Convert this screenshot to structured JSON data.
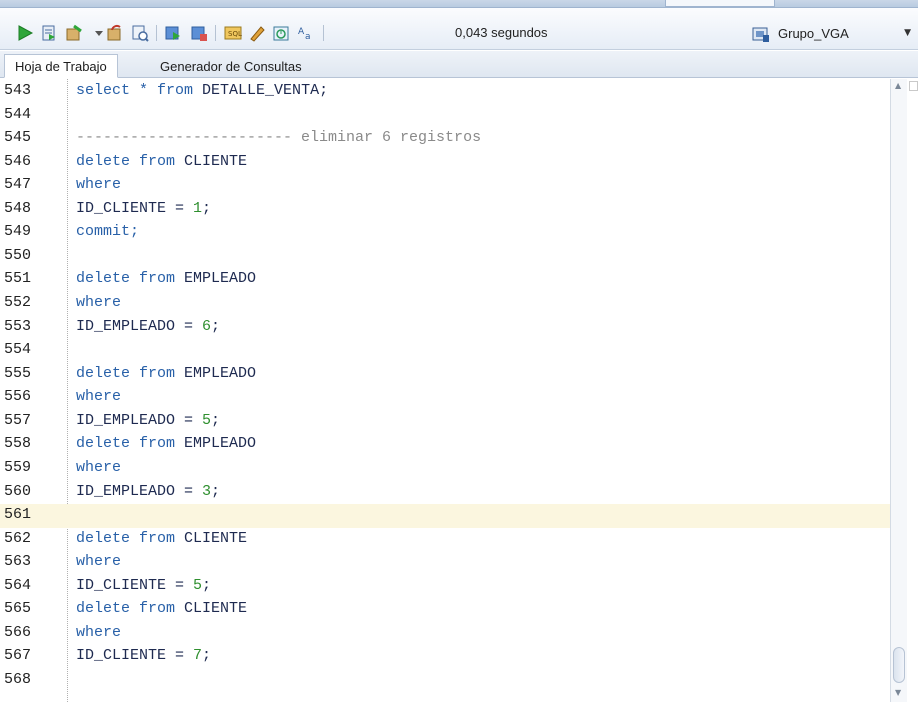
{
  "toolbar": {
    "icons": [
      "run-statement-icon",
      "run-script-icon",
      "commit-icon",
      "dropdown-arrow-icon",
      "rollback-icon",
      "autotrace-icon",
      "explain-plan-icon",
      "sql-tuning-icon",
      "unshared-sql-icon",
      "clear-icon",
      "history-icon",
      "format-case-icon"
    ],
    "timing": "0,043 segundos",
    "connection": {
      "label": "Grupo_VGA"
    }
  },
  "sub_tabs": [
    {
      "label": "Hoja de Trabajo",
      "active": true
    },
    {
      "label": "Generador de Consultas",
      "active": false
    }
  ],
  "editor": {
    "current_line": 561,
    "lines": [
      {
        "n": "543",
        "code": [
          {
            "t": "select ",
            "c": "kw"
          },
          {
            "t": "* ",
            "c": "kw"
          },
          {
            "t": "from ",
            "c": "kw"
          },
          {
            "t": "DETALLE_VENTA;",
            "c": "plain"
          }
        ]
      },
      {
        "n": "544",
        "code": []
      },
      {
        "n": "545",
        "code": [
          {
            "t": "------------------------ eliminar 6 registros",
            "c": "cmt"
          }
        ]
      },
      {
        "n": "546",
        "code": [
          {
            "t": "delete ",
            "c": "kw"
          },
          {
            "t": "from ",
            "c": "kw"
          },
          {
            "t": "CLIENTE",
            "c": "plain"
          }
        ]
      },
      {
        "n": "547",
        "code": [
          {
            "t": "where",
            "c": "kw"
          }
        ]
      },
      {
        "n": "548",
        "code": [
          {
            "t": "ID_CLIENTE = ",
            "c": "plain"
          },
          {
            "t": "1",
            "c": "num"
          },
          {
            "t": ";",
            "c": "plain"
          }
        ]
      },
      {
        "n": "549",
        "code": [
          {
            "t": "commit;",
            "c": "kw"
          }
        ]
      },
      {
        "n": "550",
        "code": []
      },
      {
        "n": "551",
        "code": [
          {
            "t": "delete ",
            "c": "kw"
          },
          {
            "t": "from ",
            "c": "kw"
          },
          {
            "t": "EMPLEADO",
            "c": "plain"
          }
        ]
      },
      {
        "n": "552",
        "code": [
          {
            "t": "where",
            "c": "kw"
          }
        ]
      },
      {
        "n": "553",
        "code": [
          {
            "t": "ID_EMPLEADO = ",
            "c": "plain"
          },
          {
            "t": "6",
            "c": "num"
          },
          {
            "t": ";",
            "c": "plain"
          }
        ]
      },
      {
        "n": "554",
        "code": []
      },
      {
        "n": "555",
        "code": [
          {
            "t": "delete ",
            "c": "kw"
          },
          {
            "t": "from ",
            "c": "kw"
          },
          {
            "t": "EMPLEADO",
            "c": "plain"
          }
        ]
      },
      {
        "n": "556",
        "code": [
          {
            "t": "where",
            "c": "kw"
          }
        ]
      },
      {
        "n": "557",
        "code": [
          {
            "t": "ID_EMPLEADO = ",
            "c": "plain"
          },
          {
            "t": "5",
            "c": "num"
          },
          {
            "t": ";",
            "c": "plain"
          }
        ]
      },
      {
        "n": "558",
        "code": [
          {
            "t": "delete ",
            "c": "kw"
          },
          {
            "t": "from ",
            "c": "kw"
          },
          {
            "t": "EMPLEADO",
            "c": "plain"
          }
        ]
      },
      {
        "n": "559",
        "code": [
          {
            "t": "where",
            "c": "kw"
          }
        ]
      },
      {
        "n": "560",
        "code": [
          {
            "t": "ID_EMPLEADO = ",
            "c": "plain"
          },
          {
            "t": "3",
            "c": "num"
          },
          {
            "t": ";",
            "c": "plain"
          }
        ]
      },
      {
        "n": "561",
        "code": []
      },
      {
        "n": "562",
        "code": [
          {
            "t": "delete ",
            "c": "kw"
          },
          {
            "t": "from ",
            "c": "kw"
          },
          {
            "t": "CLIENTE",
            "c": "plain"
          }
        ]
      },
      {
        "n": "563",
        "code": [
          {
            "t": "where",
            "c": "kw"
          }
        ]
      },
      {
        "n": "564",
        "code": [
          {
            "t": "ID_CLIENTE = ",
            "c": "plain"
          },
          {
            "t": "5",
            "c": "num"
          },
          {
            "t": ";",
            "c": "plain"
          }
        ]
      },
      {
        "n": "565",
        "code": [
          {
            "t": "delete ",
            "c": "kw"
          },
          {
            "t": "from ",
            "c": "kw"
          },
          {
            "t": "CLIENTE",
            "c": "plain"
          }
        ]
      },
      {
        "n": "566",
        "code": [
          {
            "t": "where",
            "c": "kw"
          }
        ]
      },
      {
        "n": "567",
        "code": [
          {
            "t": "ID_CLIENTE = ",
            "c": "plain"
          },
          {
            "t": "7",
            "c": "num"
          },
          {
            "t": ";",
            "c": "plain"
          }
        ]
      },
      {
        "n": "568",
        "code": []
      }
    ]
  },
  "colors": {
    "keyword": "#2860a8",
    "number": "#2f8f2f",
    "comment": "#8a8a8a",
    "current_line": "#fbf6df"
  }
}
